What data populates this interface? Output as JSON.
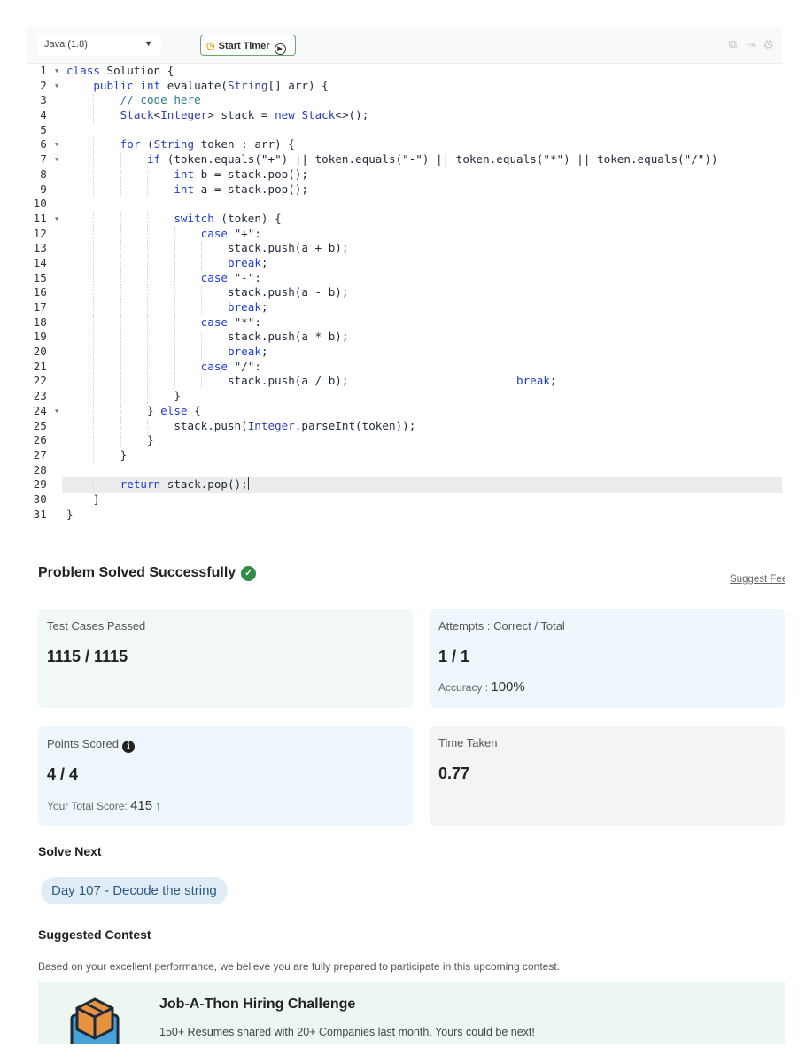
{
  "toolbar": {
    "language": "Java (1.8)",
    "start_timer_label": "Start Timer"
  },
  "code_lines": [
    "class Solution {",
    "    public int evaluate(String[] arr) {",
    "        // code here",
    "        Stack<Integer> stack = new Stack<>();",
    "",
    "        for (String token : arr) {",
    "            if (token.equals(\"+\") || token.equals(\"-\") || token.equals(\"*\") || token.equals(\"/\"))",
    "                int b = stack.pop();",
    "                int a = stack.pop();",
    "",
    "                switch (token) {",
    "                    case \"+\":",
    "                        stack.push(a + b);",
    "                        break;",
    "                    case \"-\":",
    "                        stack.push(a - b);",
    "                        break;",
    "                    case \"*\":",
    "                        stack.push(a * b);",
    "                        break;",
    "                    case \"/\":",
    "                        stack.push(a / b);                         break;",
    "                }",
    "            } else {",
    "                stack.push(Integer.parseInt(token));",
    "            }",
    "        }",
    "",
    "        return stack.pop();",
    "    }",
    "}"
  ],
  "fold_lines": [
    1,
    2,
    6,
    7,
    11,
    24
  ],
  "active_line": 29,
  "result": {
    "title": "Problem Solved Successfully",
    "suggest_feedback": "Suggest Feedback",
    "test_cases_label": "Test Cases Passed",
    "test_cases_value": "1115 / 1115",
    "attempts_label": "Attempts : Correct / Total",
    "attempts_value": "1 / 1",
    "accuracy_label": "Accuracy :",
    "accuracy_value": "100%",
    "points_label": "Points Scored",
    "points_value": "4 / 4",
    "total_score_label": "Your Total Score:",
    "total_score_value": "415",
    "time_label": "Time Taken",
    "time_value": "0.77"
  },
  "solve_next": {
    "title": "Solve Next",
    "item": "Day 107 - Decode the string"
  },
  "contest": {
    "section_title": "Suggested Contest",
    "description": "Based on your excellent performance, we believe you are fully prepared to participate in this upcoming contest.",
    "name": "Job-A-Thon Hiring Challenge",
    "tagline": "150+ Resumes shared with 20+ Companies last month. Yours could be next!"
  },
  "colors": {
    "success": "#2f8d46",
    "keyword": "#1f3fcf",
    "link": "#2a5a8a"
  }
}
